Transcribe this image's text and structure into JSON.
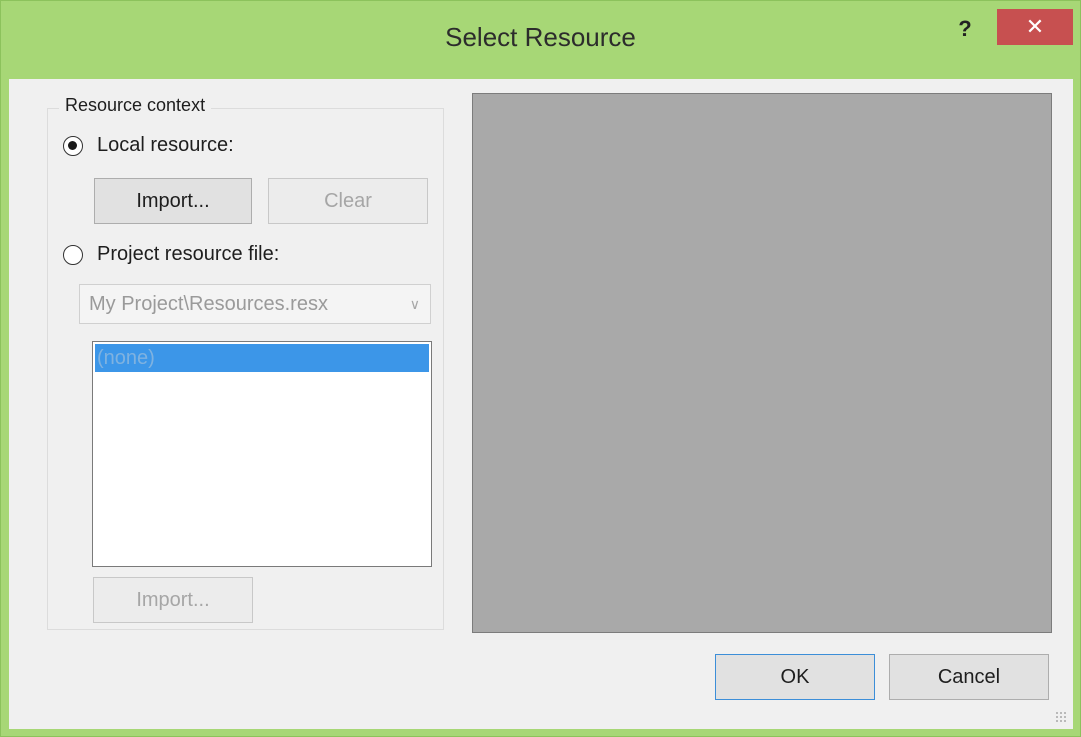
{
  "window": {
    "title": "Select Resource",
    "help_label": "?",
    "close_label": "✕"
  },
  "group": {
    "label": "Resource context"
  },
  "local": {
    "label": "Local resource:",
    "selected": true,
    "import_label": "Import...",
    "clear_label": "Clear"
  },
  "project": {
    "label": "Project resource file:",
    "selected": false,
    "combo_value": "My Project\\Resources.resx",
    "list_items": [
      "(none)"
    ],
    "import_label": "Import..."
  },
  "footer": {
    "ok_label": "OK",
    "cancel_label": "Cancel"
  },
  "colors": {
    "title_bar": "#a7d776",
    "close_button": "#c75050",
    "selection": "#3c96e8",
    "preview_bg": "#a9a9a9"
  }
}
